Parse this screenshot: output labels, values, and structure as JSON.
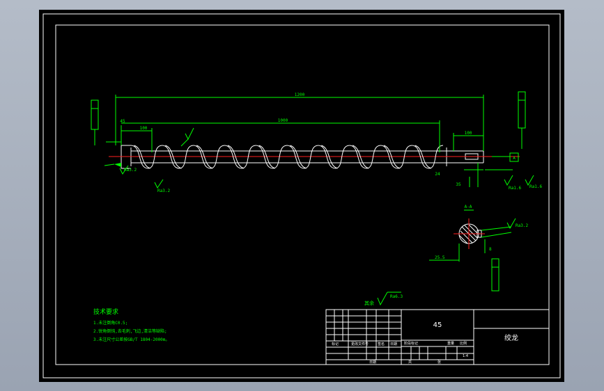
{
  "colors": {
    "background": "#000000",
    "dimension": "#00ff00",
    "outline": "#ffffff",
    "centerline": "#ff2020",
    "frame": "#a9b1be"
  },
  "dimensions": {
    "total_length": "1200",
    "screw_length": "1000",
    "left_step": "100",
    "right_step": "100",
    "pitch_mark": "45",
    "right_small": "24",
    "right_small2": "35"
  },
  "section": {
    "label": "A-A",
    "roughness": "Ra3.2",
    "dim_depth": "25.5",
    "dim_width": "8"
  },
  "roughness_labels": {
    "left": "Ra3.2",
    "left2": "Ra3.2",
    "right": "Ra1.6",
    "right2": "Ra1.6",
    "other": "Ra6.3",
    "other_prefix": "其余"
  },
  "datum": {
    "left": "A",
    "right": "A"
  },
  "tech_req": {
    "title": "技术要求",
    "items": [
      "1.未注倒角C0.5;",
      "2.锐角倒钝,去毛刺,飞边,清洁等缺陷;",
      "3.未注尺寸公差按GB/T 1804-2000m。"
    ]
  },
  "title_block": {
    "material": "45",
    "part_name": "绞龙",
    "scale": "1:4",
    "headers": [
      "标记",
      "处数",
      "分区",
      "更改文件号",
      "签名",
      "日期"
    ],
    "stage": "阶段标记",
    "weight": "重量",
    "scale_label": "比例",
    "sheet": "共",
    "sheet2": "张",
    "approve": "批准",
    "design": "设计",
    "date": "日期"
  }
}
